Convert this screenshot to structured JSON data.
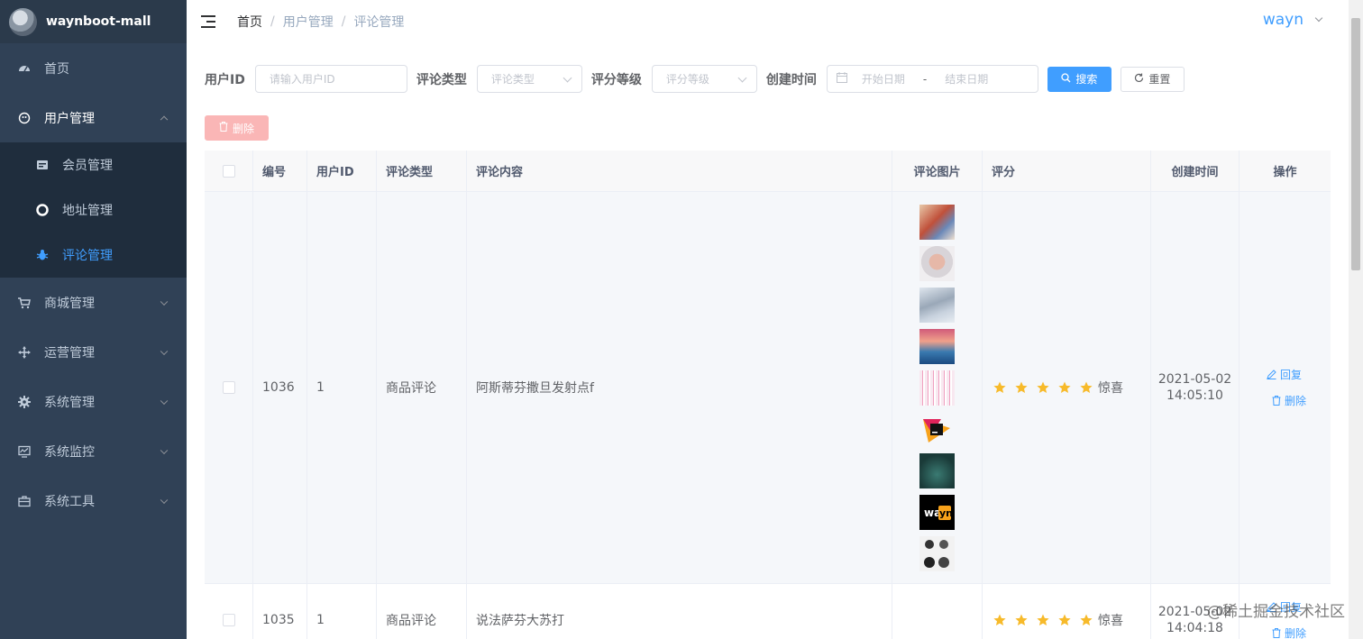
{
  "sidebar": {
    "brand": "waynboot-mall",
    "items": [
      {
        "label": "首页",
        "icon": "dashboard-icon"
      },
      {
        "label": "用户管理",
        "icon": "user-icon",
        "expanded": true,
        "children": [
          {
            "label": "会员管理",
            "icon": "member-icon"
          },
          {
            "label": "地址管理",
            "icon": "address-icon"
          },
          {
            "label": "评论管理",
            "icon": "comment-icon",
            "active": true
          }
        ]
      },
      {
        "label": "商城管理",
        "icon": "cart-icon"
      },
      {
        "label": "运营管理",
        "icon": "operation-icon"
      },
      {
        "label": "系统管理",
        "icon": "gear-icon"
      },
      {
        "label": "系统监控",
        "icon": "monitor-icon"
      },
      {
        "label": "系统工具",
        "icon": "toolbox-icon"
      }
    ]
  },
  "breadcrumb": [
    "首页",
    "用户管理",
    "评论管理"
  ],
  "user": {
    "name": "wayn"
  },
  "search": {
    "user_id_label": "用户ID",
    "user_id_placeholder": "请输入用户ID",
    "comment_type_label": "评论类型",
    "comment_type_placeholder": "评论类型",
    "rating_label": "评分等级",
    "rating_placeholder": "评分等级",
    "created_label": "创建时间",
    "start_placeholder": "开始日期",
    "range_sep": "-",
    "end_placeholder": "结束日期",
    "search_button": "搜索",
    "reset_button": "重置"
  },
  "toolbar": {
    "delete_button": "删除"
  },
  "table": {
    "headers": [
      "编号",
      "用户ID",
      "评论类型",
      "评论内容",
      "评论图片",
      "评分",
      "创建时间",
      "操作"
    ],
    "rows": [
      {
        "id": "1036",
        "user_id": "1",
        "type": "商品评论",
        "content": "阿斯蒂芬撒旦发射点f",
        "images": 9,
        "rating": 5,
        "rating_text": "惊喜",
        "date": "2021-05-02",
        "time": "14:05:10",
        "reply": "回复",
        "delete": "删除"
      },
      {
        "id": "1035",
        "user_id": "1",
        "type": "商品评论",
        "content": "说法萨芬大苏打",
        "images": 0,
        "rating": 5,
        "rating_text": "惊喜",
        "date": "2021-05-02",
        "time": "14:04:18",
        "reply": "回复",
        "delete": "删除"
      }
    ]
  },
  "watermark": "@稀土掘金技术社区",
  "colors": {
    "sidebar_bg": "#304156",
    "accent": "#409eff",
    "star": "#f7ba2a"
  }
}
